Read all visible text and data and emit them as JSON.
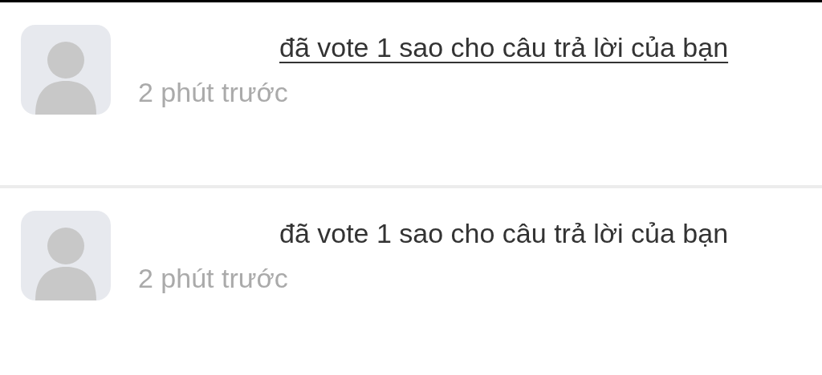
{
  "notifications": [
    {
      "message": "đã vote 1 sao cho câu trả lời của bạn",
      "time": "2 phút trước",
      "hovered": true
    },
    {
      "message": "đã vote 1 sao cho câu trả lời của bạn",
      "time": "2 phút trước",
      "hovered": false
    }
  ]
}
